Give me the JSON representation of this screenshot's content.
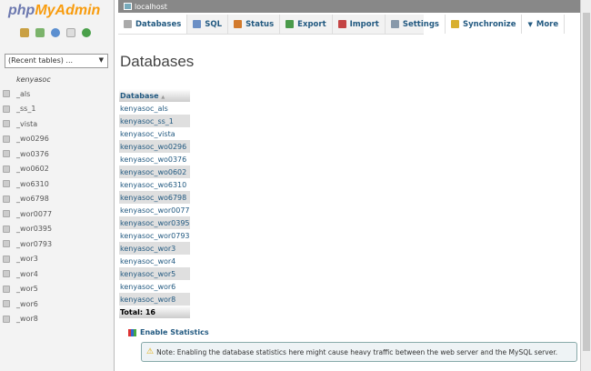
{
  "logo": {
    "php": "php",
    "my": "MyAdmin"
  },
  "sidebar": {
    "recent_tables": "(Recent tables) ...",
    "database": "kenyasoc",
    "tables": [
      "_als",
      "_ss_1",
      "_vista",
      "_wo0296",
      "_wo0376",
      "_wo0602",
      "_wo6310",
      "_wo6798",
      "_wor0077",
      "_wor0395",
      "_wor0793",
      "_wor3",
      "_wor4",
      "_wor5",
      "_wor6",
      "_wor8"
    ]
  },
  "topbar": {
    "server": "localhost"
  },
  "tabs": [
    {
      "label": "Databases",
      "icon": "database-icon",
      "color": "#aaaaaa"
    },
    {
      "label": "SQL",
      "icon": "sql-icon",
      "color": "#6b8fc5"
    },
    {
      "label": "Status",
      "icon": "status-icon",
      "color": "#d27a2c"
    },
    {
      "label": "Export",
      "icon": "export-icon",
      "color": "#4a9a4a"
    },
    {
      "label": "Import",
      "icon": "import-icon",
      "color": "#c44444"
    },
    {
      "label": "Settings",
      "icon": "settings-icon",
      "color": "#8899aa"
    },
    {
      "label": "Synchronize",
      "icon": "synchronize-icon",
      "color": "#d8b030"
    },
    {
      "label": "More",
      "icon": "chevron-down-icon",
      "color": "#333333"
    }
  ],
  "main": {
    "title": "Databases",
    "column_header": "Database",
    "sort_indicator": "▲",
    "databases": [
      "kenyasoc_als",
      "kenyasoc_ss_1",
      "kenyasoc_vista",
      "kenyasoc_wo0296",
      "kenyasoc_wo0376",
      "kenyasoc_wo0602",
      "kenyasoc_wo6310",
      "kenyasoc_wo6798",
      "kenyasoc_wor0077",
      "kenyasoc_wor0395",
      "kenyasoc_wor0793",
      "kenyasoc_wor3",
      "kenyasoc_wor4",
      "kenyasoc_wor5",
      "kenyasoc_wor6",
      "kenyasoc_wor8"
    ],
    "total": "Total: 16",
    "enable_statistics": "Enable Statistics",
    "note": "Note: Enabling the database statistics here might cause heavy traffic between the web server and the MySQL server."
  }
}
